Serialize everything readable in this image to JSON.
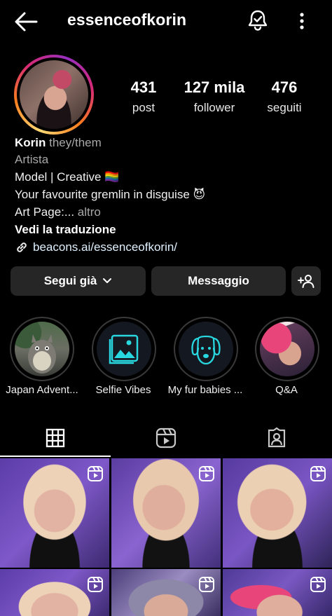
{
  "header": {
    "username": "essenceofkorin",
    "icons": [
      "back-arrow-icon",
      "notification-bell-icon",
      "more-options-icon"
    ]
  },
  "stats": [
    {
      "value": "431",
      "label": "post"
    },
    {
      "value": "127 mila",
      "label": "follower"
    },
    {
      "value": "476",
      "label": "seguiti"
    }
  ],
  "bio": {
    "name": "Korin",
    "pronouns": "they/them",
    "category": "Artista",
    "line1": "Model | Creative",
    "line1_emoji": "🏳️‍🌈",
    "line2": "Your favourite gremlin in disguise",
    "line2_emoji": "😈",
    "line3": "Art Page:...",
    "more": "altro",
    "translate": "Vedi la traduzione",
    "link": "beacons.ai/essenceofkorin/"
  },
  "actions": {
    "follow": "Segui già",
    "message": "Messaggio",
    "add_user_icon": "add-user-icon"
  },
  "highlights": [
    {
      "label": "Japan Advent..."
    },
    {
      "label": "Selfie Vibes"
    },
    {
      "label": "My fur babies ..."
    },
    {
      "label": "Q&A"
    }
  ],
  "tabs": [
    "grid-icon",
    "reels-icon",
    "tagged-icon"
  ],
  "colors": {
    "background": "#000000",
    "button": "#262626",
    "accent_cyan": "#28d7e0",
    "grid_bg": "#6a3fa0"
  }
}
